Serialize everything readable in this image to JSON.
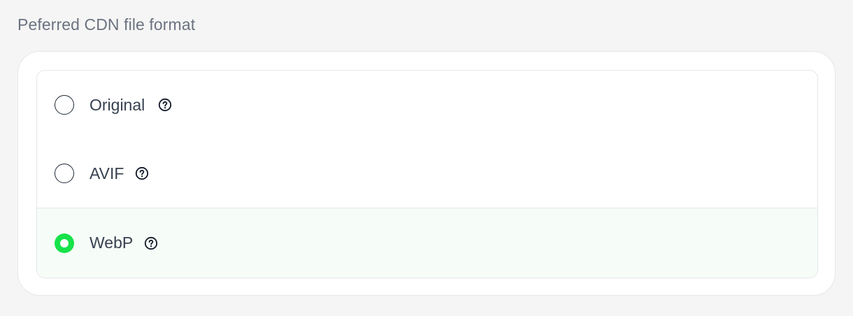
{
  "section": {
    "label": "Peferred CDN file format"
  },
  "options": [
    {
      "label": "Original",
      "selected": false,
      "icon": "help-circle-icon"
    },
    {
      "label": "AVIF",
      "selected": false,
      "icon": "help-circle-icon"
    },
    {
      "label": "WebP",
      "selected": true,
      "icon": "help-circle-icon"
    }
  ],
  "colors": {
    "accent": "#16e24a",
    "selected_row_bg": "#f6fcf7",
    "label_text": "#374151",
    "section_label_text": "#6b7280"
  }
}
